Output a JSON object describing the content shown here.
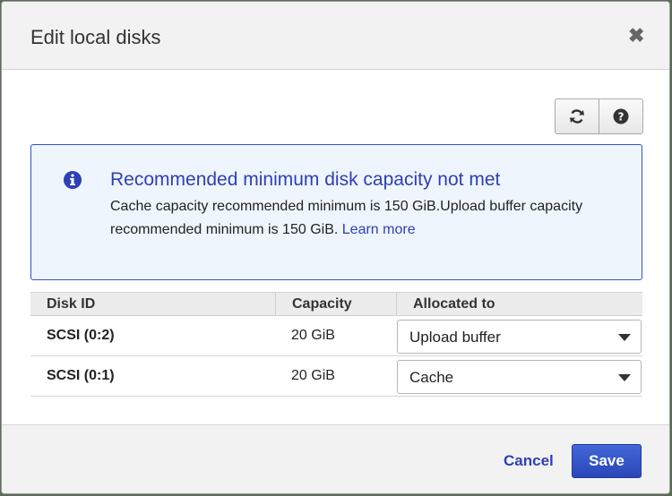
{
  "dialog": {
    "title": "Edit local disks",
    "close_icon": "close-icon"
  },
  "toolbar": {
    "refresh_icon": "refresh-icon",
    "help_icon": "help-icon"
  },
  "alert": {
    "icon": "info-icon",
    "title": "Recommended minimum disk capacity not met",
    "message": "Cache capacity recommended minimum is 150 GiB.Upload buffer capacity recommended minimum is 150 GiB.",
    "link_label": "Learn more",
    "colors": {
      "border": "#2f55c8",
      "background": "#eef5fc",
      "accent": "#2f3fb5"
    }
  },
  "table": {
    "columns": [
      "Disk ID",
      "Capacity",
      "Allocated to"
    ],
    "rows": [
      {
        "disk_id": "SCSI (0:2)",
        "capacity": "20 GiB",
        "allocated_to": "Upload buffer"
      },
      {
        "disk_id": "SCSI (0:1)",
        "capacity": "20 GiB",
        "allocated_to": "Cache"
      }
    ]
  },
  "footer": {
    "cancel_label": "Cancel",
    "save_label": "Save",
    "save_color": "#2f4fc8"
  }
}
